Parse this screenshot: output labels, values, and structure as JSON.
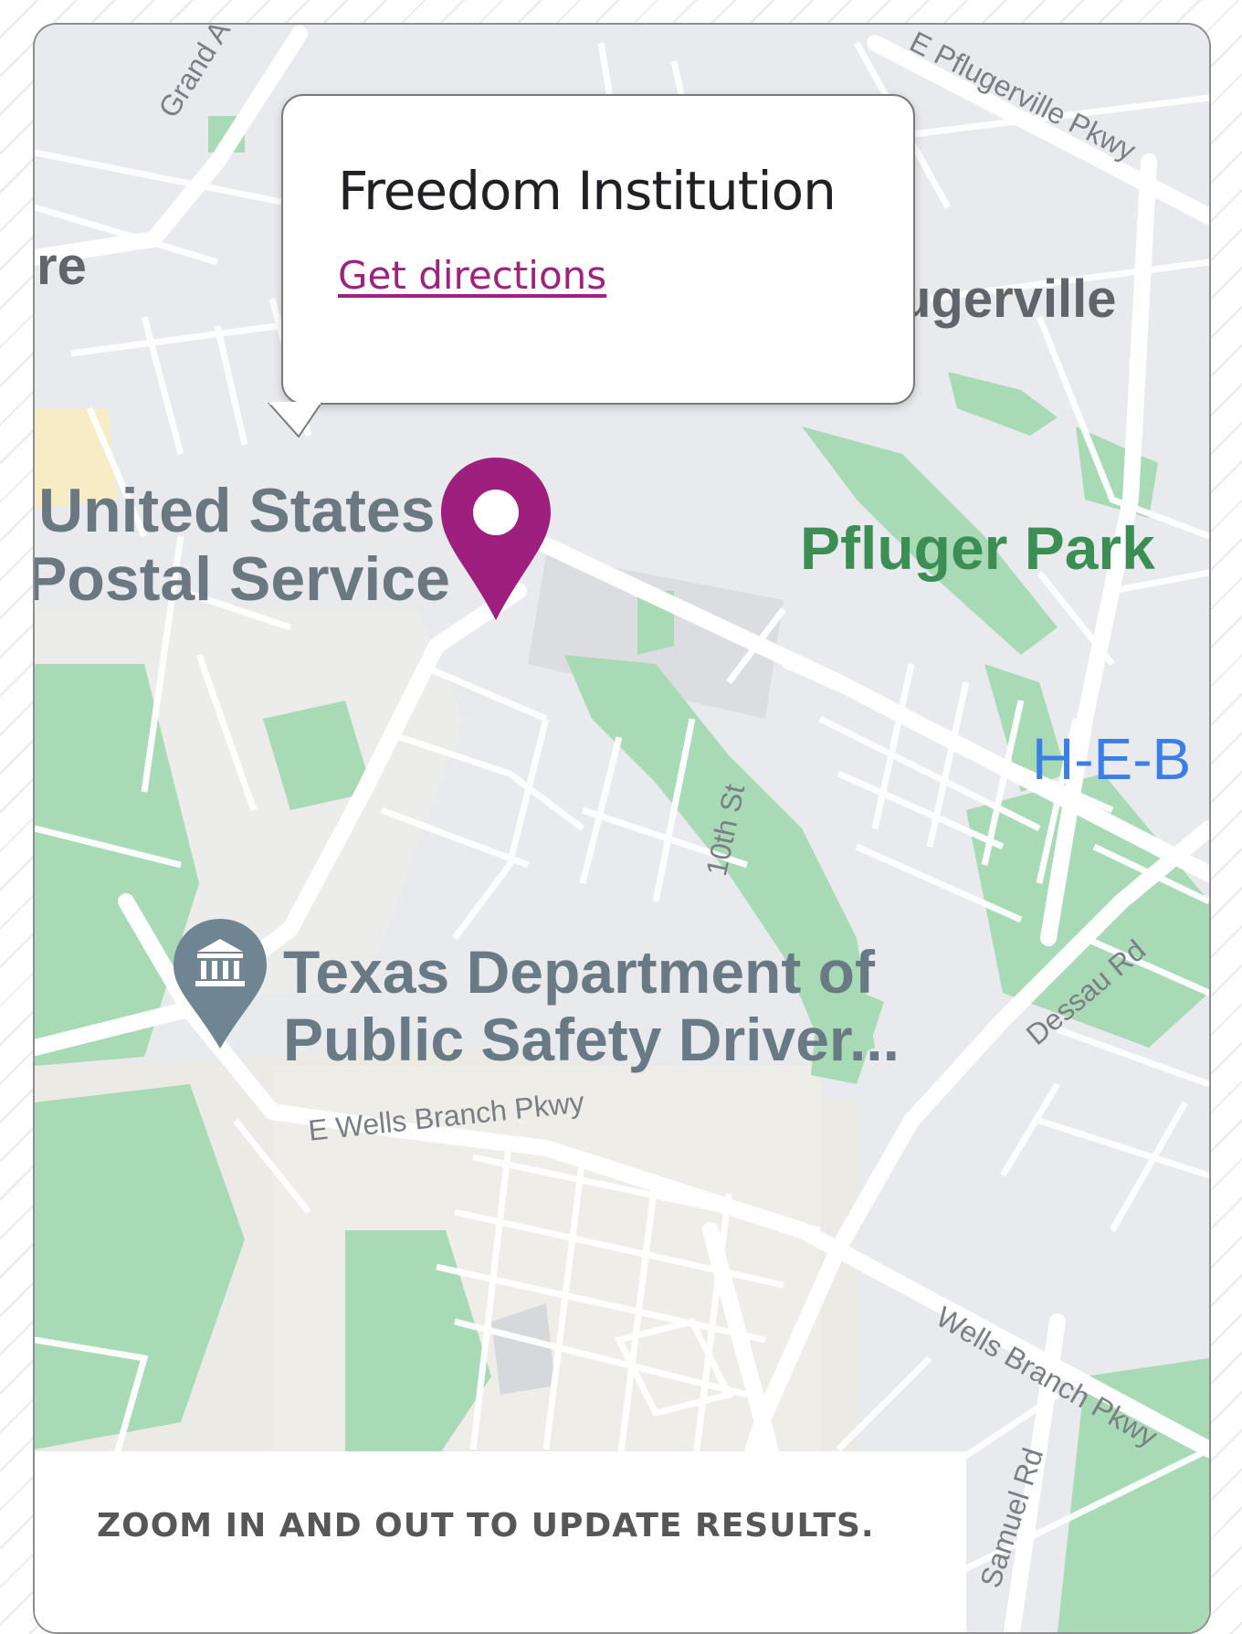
{
  "popup": {
    "title": "Freedom Institution",
    "directions_link": "Get directions"
  },
  "map_labels": {
    "usps_line1": "United States",
    "usps_line2": "Postal Service",
    "pfluger_park": "Pfluger Park",
    "heb": "H-E-B",
    "dps_line1": "Texas Department of",
    "dps_line2": "Public Safety Driver...",
    "city_partial": "ugerville",
    "city_left_partial": "re",
    "grand_ave": "Grand Ave Pkwy",
    "pflugerville_pkwy": "E Pflugerville Pkwy",
    "tenth_st": "10th St",
    "e_wells_branch": "E Wells Branch Pkwy",
    "dessau_rd": "Dessau Rd",
    "wells_branch": "Wells Branch Pkwy",
    "samuel_rd": "Samuel Rd"
  },
  "footer": {
    "hint": "ZOOM IN AND OUT TO UPDATE RESULTS."
  },
  "colors": {
    "pin": "#9e1f7d",
    "link": "#a0227f",
    "park": "#a8dab5",
    "map_bg": "#e8eaed"
  },
  "icons": {
    "pin": "map-marker-icon",
    "dps": "government-building-icon"
  }
}
